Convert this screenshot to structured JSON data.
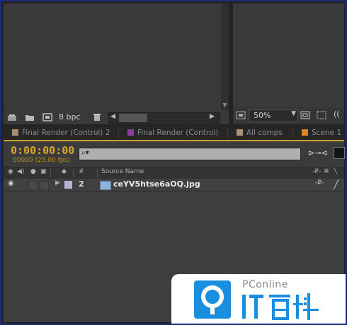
{
  "project": {
    "bpc_label": "8 bpc",
    "toolbar_icons": [
      "interpret-footage-icon",
      "new-folder-icon",
      "new-comp-icon",
      "trash-icon"
    ]
  },
  "viewer": {
    "zoom_value": "50%",
    "resolution_value": "(("
  },
  "tabs": [
    {
      "label": "Final Render (Control) 2",
      "color": "#a98e6e"
    },
    {
      "label": "Final Render (Control)",
      "color": "#8a3fa0"
    },
    {
      "label": "All comps",
      "color": "#a79471"
    },
    {
      "label": "Scene 1",
      "color": "#d88a1f"
    }
  ],
  "timeline": {
    "timecode": "0:00:00:00",
    "frame_info": "00000 (25.00 fps)",
    "search_placeholder": ""
  },
  "columns": {
    "number": "#",
    "source_name": "Source Name"
  },
  "layer": {
    "number": "2",
    "name": "ceYV5htse6aOQ.jpg",
    "label_color": "#b4b4d4"
  },
  "watermark": {
    "brand_small": "PConline",
    "brand_large": "IT百科",
    "brand_color": "#1a8fe0"
  }
}
